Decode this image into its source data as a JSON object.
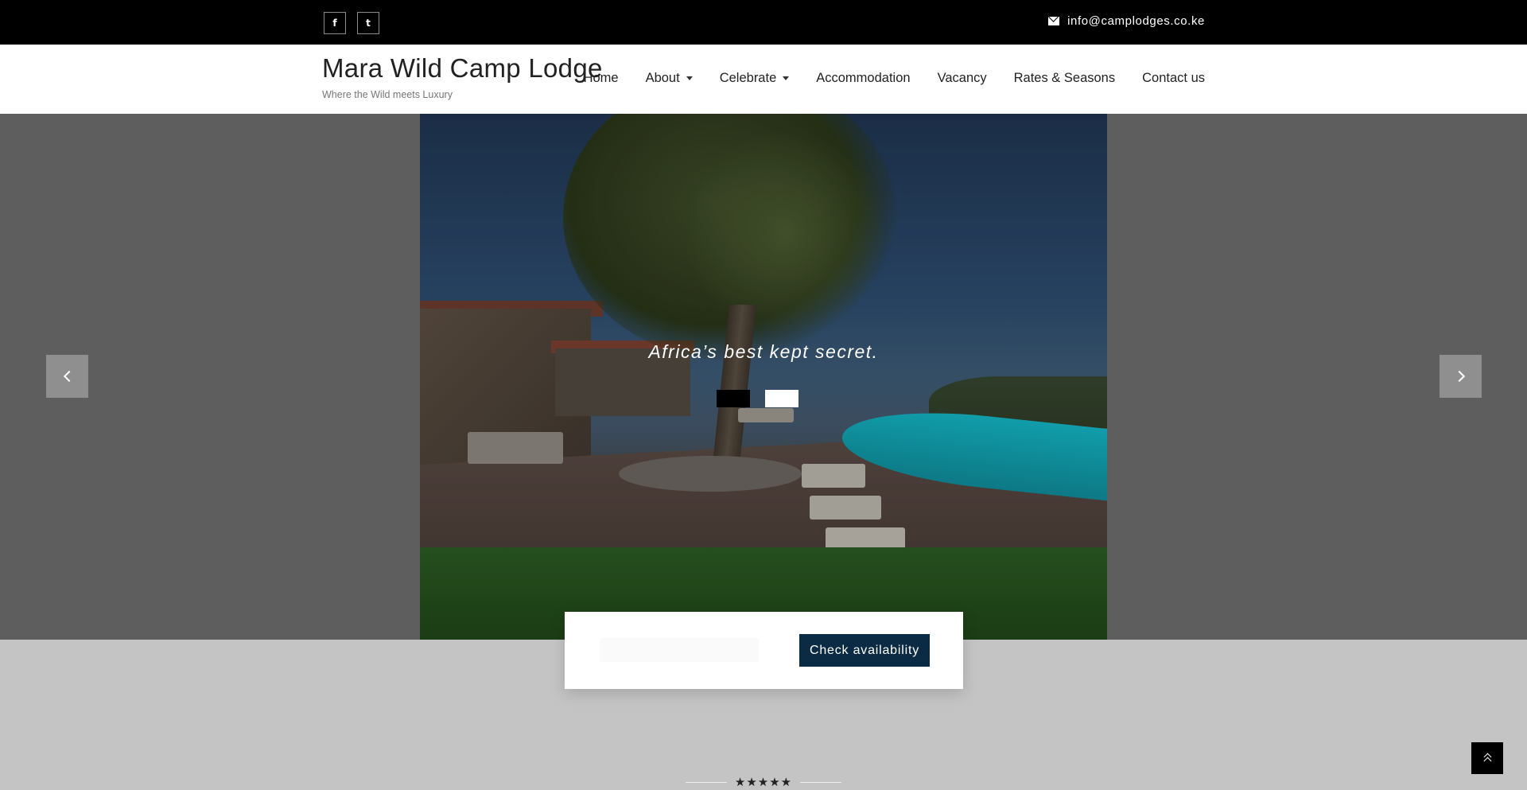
{
  "topbar": {
    "social": [
      {
        "icon": "facebook-icon",
        "glyph": "f"
      },
      {
        "icon": "twitter-icon",
        "glyph": "t"
      }
    ],
    "email": "info@camplodges.co.ke"
  },
  "header": {
    "title": "Mara Wild Camp Lodge",
    "tagline": "Where the Wild meets Luxury",
    "nav": [
      {
        "label": "Home",
        "dropdown": false
      },
      {
        "label": "About",
        "dropdown": true
      },
      {
        "label": "Celebrate",
        "dropdown": true
      },
      {
        "label": "Accommodation",
        "dropdown": false
      },
      {
        "label": "Vacancy",
        "dropdown": false
      },
      {
        "label": "Rates & Seasons",
        "dropdown": false
      },
      {
        "label": "Contact us",
        "dropdown": false
      }
    ]
  },
  "hero": {
    "caption": "Africa’s best kept secret.",
    "slide_count": 2,
    "active_slide": 2
  },
  "booking": {
    "input_value": "",
    "button_label": "Check availability"
  },
  "rating": {
    "stars": "★★★★★"
  },
  "colors": {
    "topbar": "#000000",
    "button": "#0b2b45",
    "hero_background": "#5e5e5e",
    "page_background": "#c4c4c4"
  }
}
